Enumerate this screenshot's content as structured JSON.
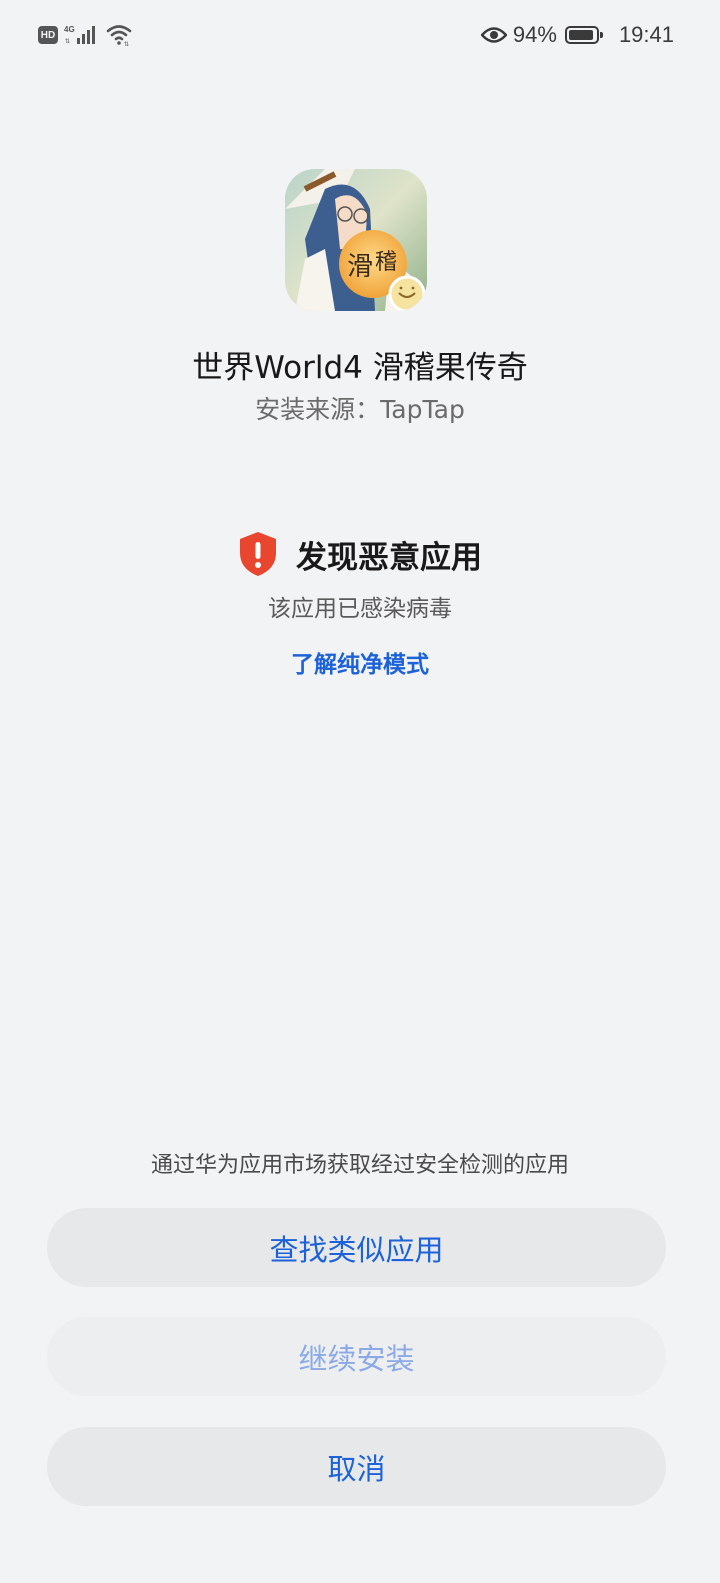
{
  "status_bar": {
    "hd_label": "HD",
    "network_label": "4G",
    "battery_percent": "94%",
    "battery_level": 0.94,
    "time": "19:41",
    "icons": [
      "signal-icon",
      "wifi-icon",
      "eye-icon",
      "battery-icon"
    ]
  },
  "app": {
    "name": "世界World4 滑稽果传奇",
    "install_source": "安装来源：TapTap",
    "icon": "app-icon"
  },
  "warning": {
    "title": "发现恶意应用",
    "description": "该应用已感染病毒",
    "link_label": "了解纯净模式",
    "icon": "shield-alert-icon",
    "color": "#e8462e"
  },
  "footer": {
    "hint": "通过华为应用市场获取经过安全检测的应用",
    "buttons": {
      "find_similar": "查找类似应用",
      "continue_install": "继续安装",
      "cancel": "取消"
    }
  },
  "colors": {
    "accent": "#1d62d8",
    "background": "#f1f3f5",
    "button_bg": "#e7e8ea",
    "disabled_text": "#8aa9e6"
  }
}
